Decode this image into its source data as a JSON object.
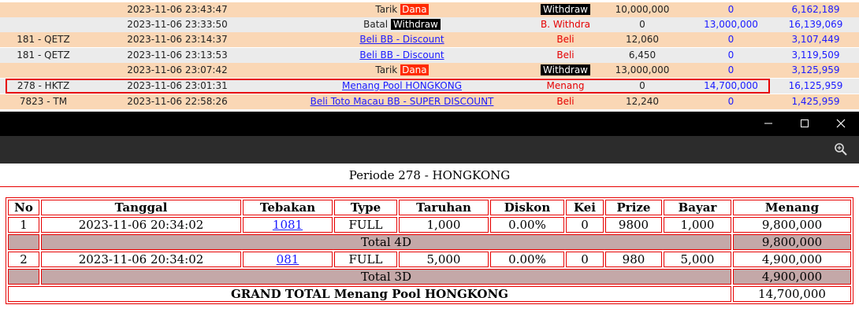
{
  "transactions": [
    {
      "id": "",
      "date": "2023-11-06 23:43:47",
      "desc_prefix": "Tarik ",
      "desc_tag": "Dana",
      "type_tag": "Withdraw",
      "debit": "10,000,000",
      "credit": "0",
      "balance": "6,162,189",
      "row_style": "peach"
    },
    {
      "id": "",
      "date": "2023-11-06 23:33:50",
      "desc_prefix": "Batal ",
      "desc_tag": "Withdraw",
      "type": "B. Withdra",
      "debit": "0",
      "credit": "13,000,000",
      "balance": "16,139,069",
      "row_style": "gray"
    },
    {
      "id": "181 - QETZ",
      "date": "2023-11-06 23:14:37",
      "desc_link": "Beli BB - Discount",
      "type": "Beli",
      "debit": "12,060",
      "credit": "0",
      "balance": "3,107,449",
      "row_style": "peach"
    },
    {
      "id": "181 - QETZ",
      "date": "2023-11-06 23:13:53",
      "desc_link": "Beli BB - Discount",
      "type": "Beli",
      "debit": "6,450",
      "credit": "0",
      "balance": "3,119,509",
      "row_style": "gray"
    },
    {
      "id": "",
      "date": "2023-11-06 23:07:42",
      "desc_prefix": "Tarik ",
      "desc_tag": "Dana",
      "type_tag": "Withdraw",
      "debit": "13,000,000",
      "credit": "0",
      "balance": "3,125,959",
      "row_style": "peach"
    },
    {
      "id": "278 - HKTZ",
      "date": "2023-11-06 23:01:31",
      "desc_link": "Menang Pool HONGKONG",
      "type": "Menang",
      "debit": "0",
      "credit": "14,700,000",
      "balance": "16,125,959",
      "row_style": "gray"
    },
    {
      "id": "7823 - TM",
      "date": "2023-11-06 22:58:26",
      "desc_link": "Beli Toto Macau BB - SUPER DISCOUNT",
      "type": "Beli",
      "debit": "12,240",
      "credit": "0",
      "balance": "1,425,959",
      "row_style": "peach"
    }
  ],
  "window": {
    "minimize_icon": "minimize-icon",
    "maximize_icon": "maximize-icon",
    "close_icon": "close-icon",
    "zoom_icon": "zoom-icon"
  },
  "result": {
    "periode": "Periode 278 - HONGKONG",
    "headers": [
      "No",
      "Tanggal",
      "Tebakan",
      "Type",
      "Taruhan",
      "Diskon",
      "Kei",
      "Prize",
      "Bayar",
      "Menang"
    ],
    "bets": [
      {
        "no": "1",
        "tanggal": "2023-11-06 20:34:02",
        "tebakan": "1081",
        "type": "FULL",
        "taruhan": "1,000",
        "diskon": "0.00%",
        "kei": "0",
        "prize": "9800",
        "bayar": "1,000",
        "menang": "9,800,000",
        "total_label": "Total 4D",
        "total_amount": "9,800,000"
      },
      {
        "no": "2",
        "tanggal": "2023-11-06 20:34:02",
        "tebakan": "081",
        "type": "FULL",
        "taruhan": "5,000",
        "diskon": "0.00%",
        "kei": "0",
        "prize": "980",
        "bayar": "5,000",
        "menang": "4,900,000",
        "total_label": "Total 3D",
        "total_amount": "4,900,000"
      }
    ],
    "grand_total_label": "GRAND TOTAL  Menang Pool HONGKONG",
    "grand_total_amount": "14,700,000"
  },
  "colors": {
    "accent_red": "#e60000",
    "link_blue": "#1a1aff",
    "peach": "#fad7b5",
    "total_row": "#c4a8a8"
  }
}
